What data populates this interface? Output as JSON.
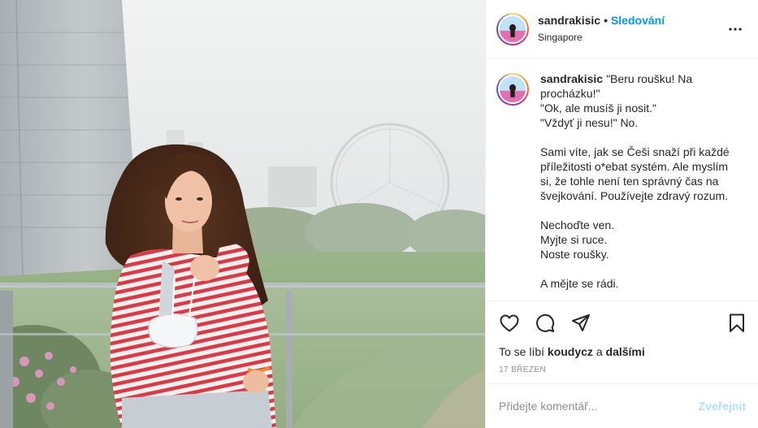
{
  "post": {
    "author": "sandrakisic",
    "follow_label": "Sledování",
    "separator": "•",
    "location": "Singapore"
  },
  "caption": {
    "username": "sandrakisic",
    "paragraphs": [
      "\"Beru roušku! Na procházku!\"\n\"Ok, ale musíš ji nosit.\"\n\"Vždyť ji nesu!\" No.",
      "Sami víte, jak se Češi snaží při každé příležitosti o*ebat systém. Ale myslím si, že tohle není ten správný čas na švejkování. Používejte zdravý rozum.",
      "Nechoďte ven.\nMyjte si ruce.\nNoste roušky.",
      "A mějte se rádi."
    ]
  },
  "likes": {
    "prefix": "To se líbí",
    "user": "koudycz",
    "conjunction": "a",
    "others": "dalšími"
  },
  "date": "17 BŘEZEN",
  "comment": {
    "placeholder": "Přidejte komentář...",
    "publish_label": "Zveřejnit"
  },
  "icons": {
    "more": "more-options-icon",
    "like": "heart-icon",
    "comment": "comment-icon",
    "share": "share-icon",
    "save": "bookmark-icon"
  },
  "colors": {
    "link_blue": "#0095f6",
    "publish_disabled": "#b2dffc",
    "muted": "#8e8e8e",
    "text": "#262626",
    "stripe_red": "#d93a45"
  }
}
